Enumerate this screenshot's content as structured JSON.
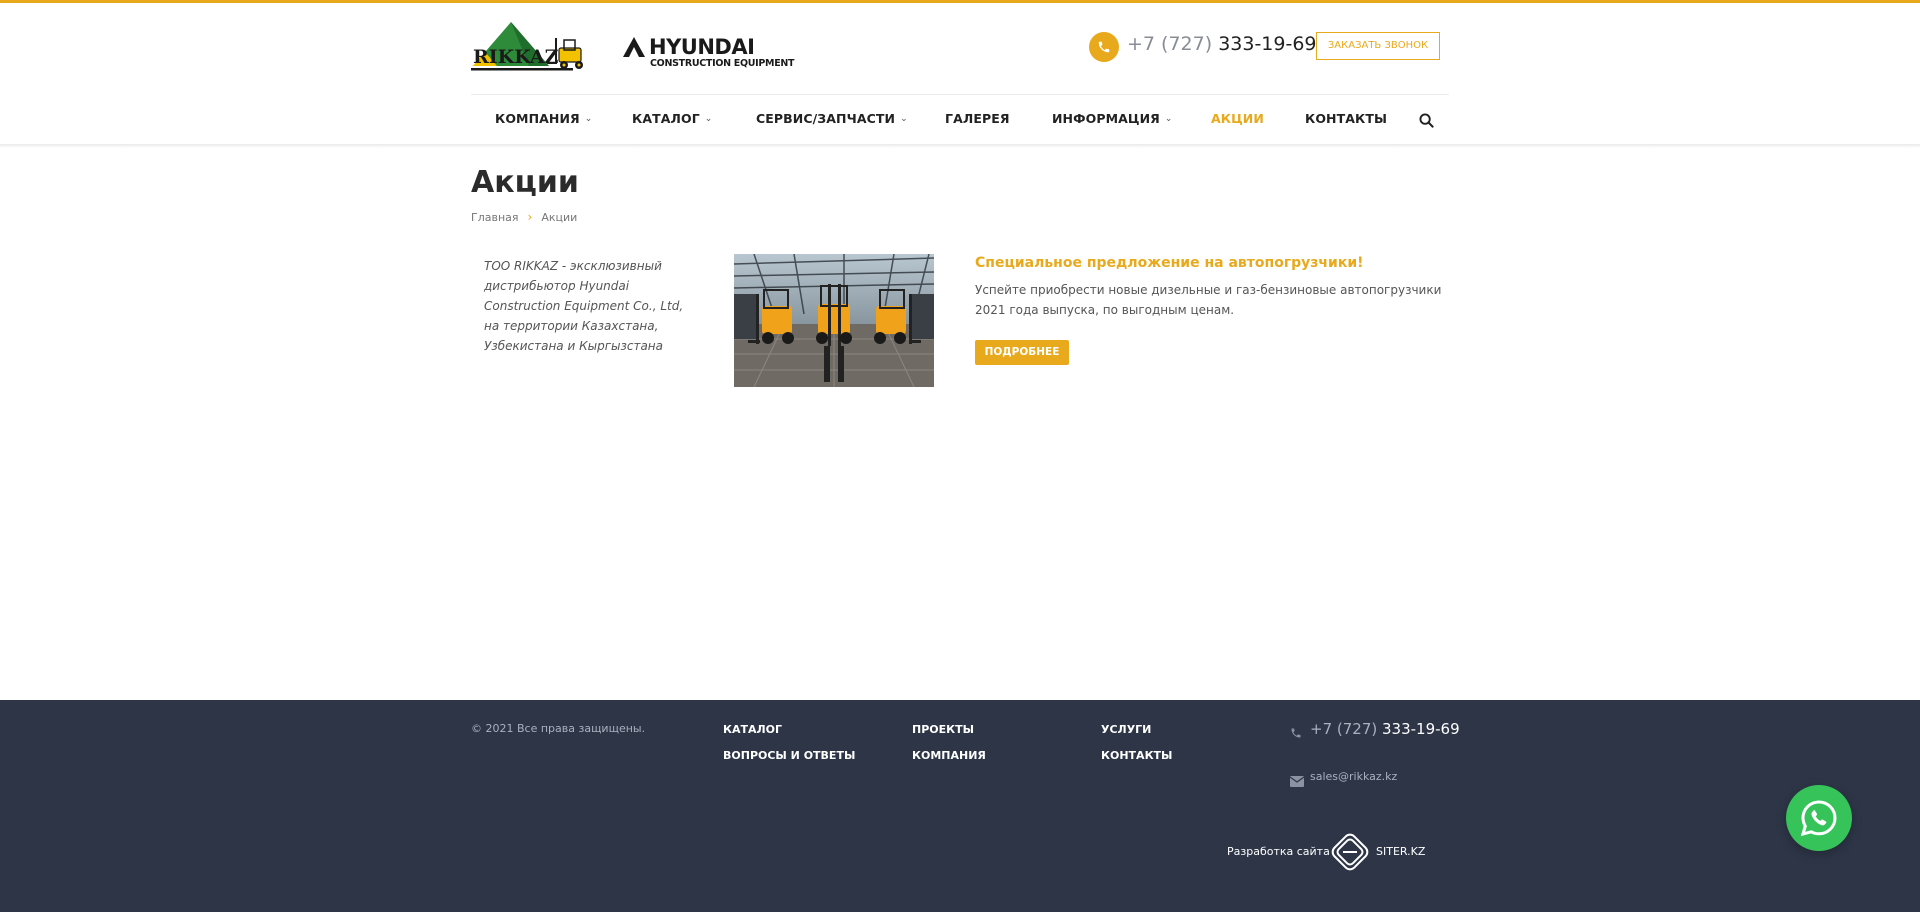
{
  "brand": {
    "rikkaz_text": "RIKKAZ",
    "hyundai_name": "HYUNDAI",
    "hyundai_sub": "CONSTRUCTION EQUIPMENT",
    "accent": "#e8a91c",
    "logo_green": "#2e8b3a",
    "logo_yellow": "#f2c200"
  },
  "header": {
    "phone_code": "+7 (727)",
    "phone_number": "333-19-69",
    "callback_label": "Заказать звонок"
  },
  "nav": {
    "items": [
      {
        "label": "КОМПАНИЯ",
        "chevron": "chevron-down-icon"
      },
      {
        "label": "КАТАЛОГ",
        "chevron": "chevron-down-icon"
      },
      {
        "label": "СЕРВИС/ЗАПЧАСТИ",
        "chevron": "chevron-down-icon"
      },
      {
        "label": "ГАЛЕРЕЯ"
      },
      {
        "label": "ИНФОРМАЦИЯ",
        "chevron": "chevron-down-icon"
      },
      {
        "label": "АКЦИИ",
        "active": true
      },
      {
        "label": "КОНТАКТЫ"
      }
    ],
    "search_icon": "search-icon"
  },
  "page": {
    "title": "Акции",
    "breadcrumb": {
      "home": "Главная",
      "separator": "›",
      "current": "Акции"
    },
    "about": "ТОО RIKKAZ - эксклюзивный дистрибьютор Hyundai Construction Equipment Co., Ltd, на территории Казахстана, Узбекистана и Кыргызстана"
  },
  "promo": {
    "title": "Специальное предложение на автопогрузчики!",
    "text": "Успейте приобрести новые дизельные и газ-бензиновые автопогрузчики 2021 года выпуска, по выгодным ценам.",
    "button": "Подробнее"
  },
  "footer": {
    "copyright": "© 2021 Все права защищены.",
    "links": [
      {
        "label": "Каталог"
      },
      {
        "label": "Вопросы и ответы"
      },
      {
        "label": "Проекты"
      },
      {
        "label": "Компания"
      },
      {
        "label": "Услуги"
      },
      {
        "label": "Контакты"
      }
    ],
    "phone_code": "+7 (727)",
    "phone_number": "333-19-69",
    "email": "sales@rikkaz.kz",
    "dev_label": "Разработка сайта",
    "dev_name": "SITER.KZ",
    "bg": "#2d3547"
  },
  "widgets": {
    "whatsapp_icon": "whatsapp-icon",
    "whatsapp_color": "#36c45a"
  }
}
